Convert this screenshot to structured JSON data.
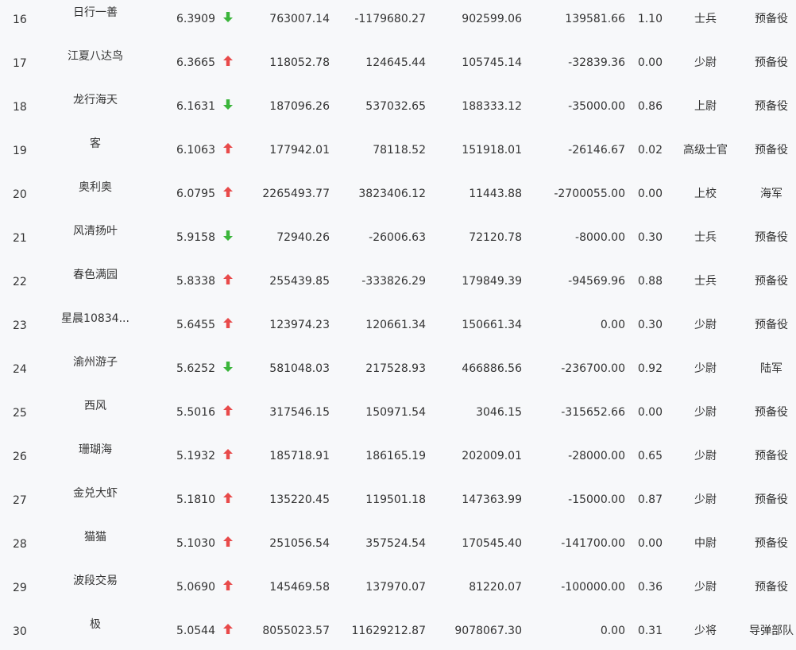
{
  "colors": {
    "background": "#f7f8fa",
    "text": "#333333",
    "up": "#e84a4a",
    "down": "#3bb53b"
  },
  "rows": [
    {
      "rank": "16",
      "name": "日行一善",
      "score": "6.3909",
      "trend": "down",
      "v1": "763007.14",
      "v2": "-1179680.27",
      "v3": "902599.06",
      "v4": "139581.66",
      "ratio": "1.10",
      "military_rank": "士兵",
      "branch": "预备役"
    },
    {
      "rank": "17",
      "name": "江夏八达鸟",
      "score": "6.3665",
      "trend": "up",
      "v1": "118052.78",
      "v2": "124645.44",
      "v3": "105745.14",
      "v4": "-32839.36",
      "ratio": "0.00",
      "military_rank": "少尉",
      "branch": "预备役"
    },
    {
      "rank": "18",
      "name": "龙行海天",
      "score": "6.1631",
      "trend": "down",
      "v1": "187096.26",
      "v2": "537032.65",
      "v3": "188333.12",
      "v4": "-35000.00",
      "ratio": "0.86",
      "military_rank": "上尉",
      "branch": "预备役"
    },
    {
      "rank": "19",
      "name": "客",
      "score": "6.1063",
      "trend": "up",
      "v1": "177942.01",
      "v2": "78118.52",
      "v3": "151918.01",
      "v4": "-26146.67",
      "ratio": "0.02",
      "military_rank": "高级士官",
      "branch": "预备役"
    },
    {
      "rank": "20",
      "name": "奥利奥",
      "score": "6.0795",
      "trend": "up",
      "v1": "2265493.77",
      "v2": "3823406.12",
      "v3": "11443.88",
      "v4": "-2700055.00",
      "ratio": "0.00",
      "military_rank": "上校",
      "branch": "海军"
    },
    {
      "rank": "21",
      "name": "风清扬叶",
      "score": "5.9158",
      "trend": "down",
      "v1": "72940.26",
      "v2": "-26006.63",
      "v3": "72120.78",
      "v4": "-8000.00",
      "ratio": "0.30",
      "military_rank": "士兵",
      "branch": "预备役"
    },
    {
      "rank": "22",
      "name": "春色满园",
      "score": "5.8338",
      "trend": "up",
      "v1": "255439.85",
      "v2": "-333826.29",
      "v3": "179849.39",
      "v4": "-94569.96",
      "ratio": "0.88",
      "military_rank": "士兵",
      "branch": "预备役"
    },
    {
      "rank": "23",
      "name": "星晨10834...",
      "score": "5.6455",
      "trend": "up",
      "v1": "123974.23",
      "v2": "120661.34",
      "v3": "150661.34",
      "v4": "0.00",
      "ratio": "0.30",
      "military_rank": "少尉",
      "branch": "预备役"
    },
    {
      "rank": "24",
      "name": "渝州游子",
      "score": "5.6252",
      "trend": "down",
      "v1": "581048.03",
      "v2": "217528.93",
      "v3": "466886.56",
      "v4": "-236700.00",
      "ratio": "0.92",
      "military_rank": "少尉",
      "branch": "陆军"
    },
    {
      "rank": "25",
      "name": "西风",
      "score": "5.5016",
      "trend": "up",
      "v1": "317546.15",
      "v2": "150971.54",
      "v3": "3046.15",
      "v4": "-315652.66",
      "ratio": "0.00",
      "military_rank": "少尉",
      "branch": "预备役"
    },
    {
      "rank": "26",
      "name": "珊瑚海",
      "score": "5.1932",
      "trend": "up",
      "v1": "185718.91",
      "v2": "186165.19",
      "v3": "202009.01",
      "v4": "-28000.00",
      "ratio": "0.65",
      "military_rank": "少尉",
      "branch": "预备役"
    },
    {
      "rank": "27",
      "name": "金兑大虾",
      "score": "5.1810",
      "trend": "up",
      "v1": "135220.45",
      "v2": "119501.18",
      "v3": "147363.99",
      "v4": "-15000.00",
      "ratio": "0.87",
      "military_rank": "少尉",
      "branch": "预备役"
    },
    {
      "rank": "28",
      "name": "猫猫",
      "score": "5.1030",
      "trend": "up",
      "v1": "251056.54",
      "v2": "357524.54",
      "v3": "170545.40",
      "v4": "-141700.00",
      "ratio": "0.00",
      "military_rank": "中尉",
      "branch": "预备役"
    },
    {
      "rank": "29",
      "name": "波段交易",
      "score": "5.0690",
      "trend": "up",
      "v1": "145469.58",
      "v2": "137970.07",
      "v3": "81220.07",
      "v4": "-100000.00",
      "ratio": "0.36",
      "military_rank": "少尉",
      "branch": "预备役"
    },
    {
      "rank": "30",
      "name": "极",
      "score": "5.0544",
      "trend": "up",
      "v1": "8055023.57",
      "v2": "11629212.87",
      "v3": "9078067.30",
      "v4": "0.00",
      "ratio": "0.31",
      "military_rank": "少将",
      "branch": "导弹部队"
    }
  ]
}
